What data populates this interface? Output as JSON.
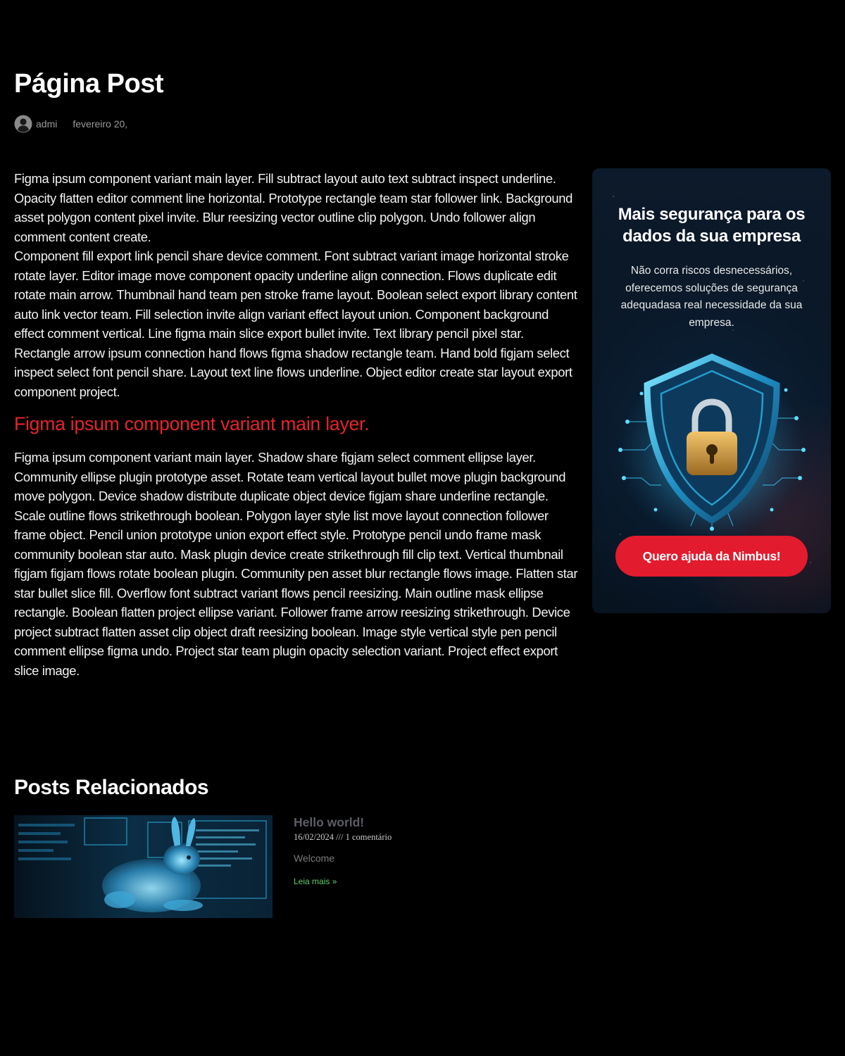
{
  "post": {
    "title": "Página Post",
    "author": "admi",
    "date": "fevereiro 20,"
  },
  "content": {
    "paragraph_1": "Figma ipsum component variant main layer. Fill subtract layout auto text subtract inspect underline. Opacity flatten editor comment line horizontal. Prototype rectangle team star follower link. Background asset polygon content pixel invite. Blur reesizing vector outline clip polygon. Undo follower align comment content create.",
    "paragraph_2": "Component fill export link pencil share device comment. Font subtract variant image horizontal stroke rotate layer. Editor image move component opacity underline align connection. Flows duplicate edit rotate main arrow. Thumbnail hand team pen stroke frame layout. Boolean select export library content auto link vector team. Fill selection invite align variant effect layout union. Component background effect comment vertical. Line figma main slice export bullet invite. Text library pencil pixel star. Rectangle arrow ipsum connection hand flows figma shadow rectangle team. Hand bold figjam select inspect select font pencil share. Layout text line flows underline. Object editor create star layout export component project.",
    "subheading": "Figma ipsum component variant main layer.",
    "paragraph_3": "Figma ipsum component variant main layer. Shadow share figjam select comment ellipse layer. Community ellipse plugin prototype asset. Rotate team vertical layout bullet move plugin background move polygon. Device shadow distribute duplicate object device figjam share underline rectangle. Scale outline flows strikethrough boolean. Polygon layer style list move layout connection follower frame object. Pencil union prototype union export effect style. Prototype pencil undo frame mask community boolean star auto. Mask plugin device create strikethrough fill clip text. Vertical thumbnail figjam figjam flows rotate boolean plugin. Community pen asset blur rectangle flows image. Flatten star star bullet slice fill. Overflow font subtract variant flows pencil reesizing. Main outline mask ellipse rectangle. Boolean flatten project ellipse variant. Follower frame arrow reesizing strikethrough. Device project subtract flatten asset clip object draft reesizing boolean. Image style vertical style pen pencil comment ellipse figma undo. Project star team plugin opacity selection variant. Project effect export slice image."
  },
  "banner": {
    "title": "Mais segurança para os dados da sua empresa",
    "text": "Não corra riscos desnecessários, oferecemos soluções de segurança adequadasa real necessidade da sua empresa.",
    "cta_label": "Quero ajuda da Nimbus!",
    "cta_color": "#e31b2e"
  },
  "related": {
    "heading": "Posts Relacionados",
    "posts": [
      {
        "title": "Hello world!",
        "date": "16/02/2024",
        "separator": "///",
        "comments": "1 comentário",
        "excerpt": "Welcome",
        "read_more": "Leia mais »"
      }
    ]
  },
  "colors": {
    "background": "#000000",
    "accent_red": "#e5242c",
    "link_green": "#61ce70"
  },
  "icons": {
    "author": "user-circle-icon"
  }
}
